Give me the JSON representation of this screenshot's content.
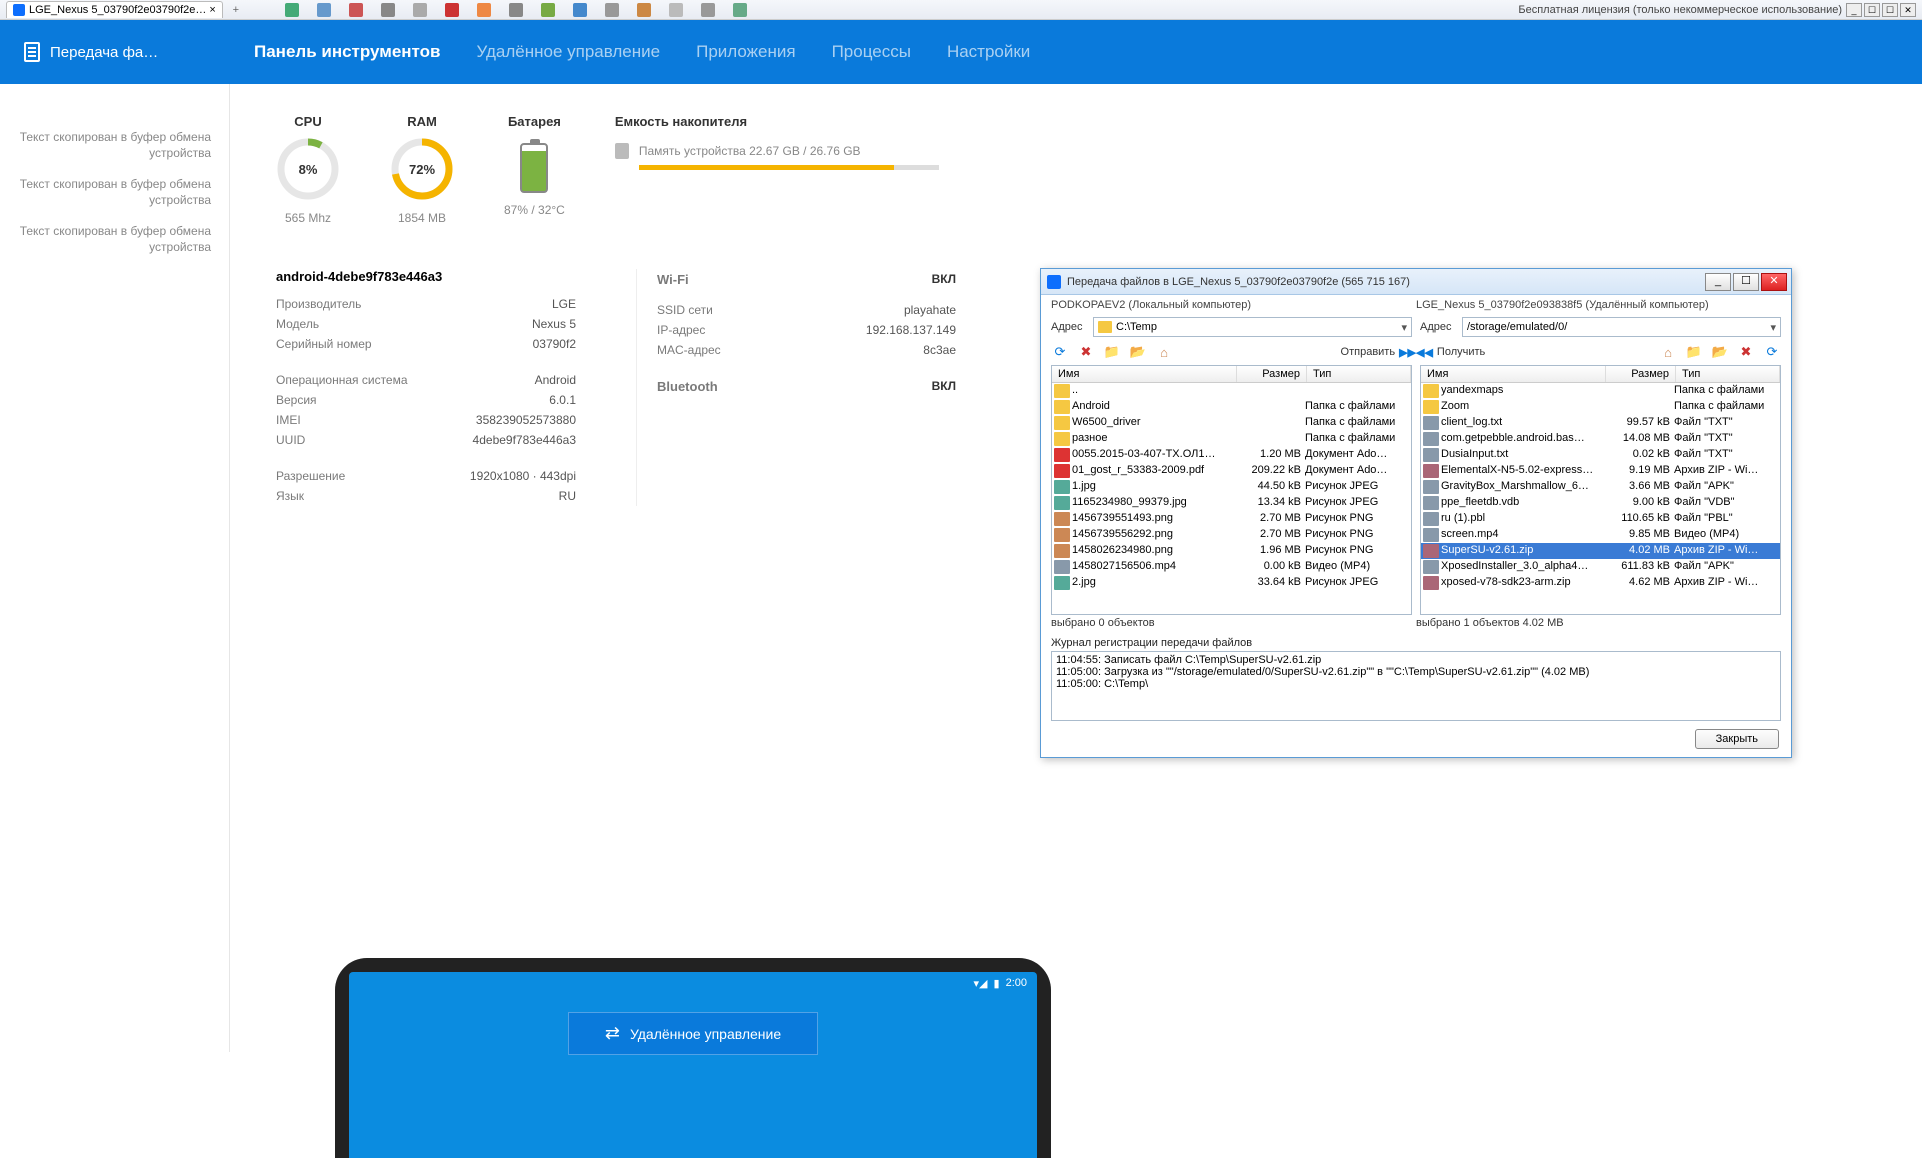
{
  "browser": {
    "tab_title": "LGE_Nexus 5_03790f2e03790f2e… ×",
    "license": "Бесплатная лицензия (только некоммерческое использование)"
  },
  "topbar": {
    "app_title": "Передача фа…",
    "nav": {
      "panel": "Панель инструментов",
      "remote": "Удалённое управление",
      "apps": "Приложения",
      "proc": "Процессы",
      "settings": "Настройки"
    }
  },
  "sidebar": {
    "msg": "Текст скопирован в буфер обмена устройства"
  },
  "stats": {
    "cpu_label": "CPU",
    "cpu_pct": "8%",
    "cpu_sub": "565 Mhz",
    "ram_label": "RAM",
    "ram_pct": "72%",
    "ram_sub": "1854 MB",
    "bat_label": "Батарея",
    "bat_sub": "87% / 32°C",
    "storage_label": "Емкость накопителя",
    "storage_text": "Память устройства 22.67 GB / 26.76 GB"
  },
  "device": {
    "id": "android-4debe9f783e446a3",
    "rows1": [
      {
        "k": "Производитель",
        "v": "LGE"
      },
      {
        "k": "Модель",
        "v": "Nexus 5"
      },
      {
        "k": "Серийный номер",
        "v": "03790f2"
      }
    ],
    "rows2": [
      {
        "k": "Операционная система",
        "v": "Android"
      },
      {
        "k": "Версия",
        "v": "6.0.1"
      },
      {
        "k": "IMEI",
        "v": "358239052573880"
      },
      {
        "k": "UUID",
        "v": "4debe9f783e446a3"
      }
    ],
    "rows3": [
      {
        "k": "Разрешение",
        "v": "1920x1080 · 443dpi"
      },
      {
        "k": "Язык",
        "v": "RU"
      }
    ],
    "wifi_h": "Wi-Fi",
    "wifi_on": "ВКЛ",
    "wrows": [
      {
        "k": "SSID сети",
        "v": "playahate"
      },
      {
        "k": "IP-адрес",
        "v": "192.168.137.149"
      },
      {
        "k": "MAC-адрес",
        "v": "8c3ae"
      }
    ],
    "bt_h": "Bluetooth",
    "bt_on": "ВКЛ"
  },
  "ft": {
    "title": "Передача файлов в LGE_Nexus 5_03790f2e03790f2e (565 715 167)",
    "local_label": "PODKOPAEV2 (Локальный компьютер)",
    "remote_label": "LGE_Nexus 5_03790f2e093838f5 (Удалённый компьютер)",
    "addr_label": "Адрес",
    "local_path": "C:\\Temp",
    "remote_path": "/storage/emulated/0/",
    "send": "Отправить",
    "recv": "Получить",
    "col_name": "Имя",
    "col_size": "Размер",
    "col_type": "Тип",
    "local_files": [
      {
        "ico": "fld",
        "n": "..",
        "s": "",
        "t": ""
      },
      {
        "ico": "fld",
        "n": "Android",
        "s": "",
        "t": "Папка с файлами"
      },
      {
        "ico": "fld",
        "n": "W6500_driver",
        "s": "",
        "t": "Папка с файлами"
      },
      {
        "ico": "fld",
        "n": "разное",
        "s": "",
        "t": "Папка с файлами"
      },
      {
        "ico": "pdf",
        "n": "0055.2015-03-407-ТХ.ОЛ1…",
        "s": "1.20 MB",
        "t": "Документ Ado…"
      },
      {
        "ico": "pdf",
        "n": "01_gost_r_53383-2009.pdf",
        "s": "209.22 kB",
        "t": "Документ Ado…"
      },
      {
        "ico": "img",
        "n": "1.jpg",
        "s": "44.50 kB",
        "t": "Рисунок JPEG"
      },
      {
        "ico": "img",
        "n": "1165234980_99379.jpg",
        "s": "13.34 kB",
        "t": "Рисунок JPEG"
      },
      {
        "ico": "png",
        "n": "1456739551493.png",
        "s": "2.70 MB",
        "t": "Рисунок PNG"
      },
      {
        "ico": "png",
        "n": "1456739556292.png",
        "s": "2.70 MB",
        "t": "Рисунок PNG"
      },
      {
        "ico": "png",
        "n": "1458026234980.png",
        "s": "1.96 MB",
        "t": "Рисунок PNG"
      },
      {
        "ico": "doc",
        "n": "1458027156506.mp4",
        "s": "0.00 kB",
        "t": "Видео (MP4)"
      },
      {
        "ico": "img",
        "n": "2.jpg",
        "s": "33.64 kB",
        "t": "Рисунок JPEG"
      }
    ],
    "remote_files": [
      {
        "ico": "fld",
        "n": "yandexmaps",
        "s": "",
        "t": "Папка с файлами"
      },
      {
        "ico": "fld",
        "n": "Zoom",
        "s": "",
        "t": "Папка с файлами"
      },
      {
        "ico": "doc",
        "n": "client_log.txt",
        "s": "99.57 kB",
        "t": "Файл \"TXT\""
      },
      {
        "ico": "doc",
        "n": "com.getpebble.android.bas…",
        "s": "14.08 MB",
        "t": "Файл \"TXT\""
      },
      {
        "ico": "doc",
        "n": "DusiaInput.txt",
        "s": "0.02 kB",
        "t": "Файл \"TXT\""
      },
      {
        "ico": "zip",
        "n": "ElementalX-N5-5.02-express…",
        "s": "9.19 MB",
        "t": "Архив ZIP - Wi…"
      },
      {
        "ico": "doc",
        "n": "GravityBox_Marshmallow_6…",
        "s": "3.66 MB",
        "t": "Файл \"APK\""
      },
      {
        "ico": "doc",
        "n": "ppe_fleetdb.vdb",
        "s": "9.00 kB",
        "t": "Файл \"VDB\""
      },
      {
        "ico": "doc",
        "n": "ru (1).pbl",
        "s": "110.65 kB",
        "t": "Файл \"PBL\""
      },
      {
        "ico": "doc",
        "n": "screen.mp4",
        "s": "9.85 MB",
        "t": "Видео (MP4)"
      },
      {
        "ico": "zip",
        "n": "SuperSU-v2.61.zip",
        "s": "4.02 MB",
        "t": "Архив ZIP - Wi…",
        "sel": true
      },
      {
        "ico": "doc",
        "n": "XposedInstaller_3.0_alpha4…",
        "s": "611.83 kB",
        "t": "Файл \"APK\""
      },
      {
        "ico": "zip",
        "n": "xposed-v78-sdk23-arm.zip",
        "s": "4.62 MB",
        "t": "Архив ZIP - Wi…"
      }
    ],
    "status_l": "выбрано 0 объектов",
    "status_r": "выбрано 1 объектов   4.02 MB",
    "log_h": "Журнал регистрации передачи файлов",
    "log": [
      "11:04:55: Записать файл C:\\Temp\\SuperSU-v2.61.zip",
      "11:05:00: Загрузка из \"\"/storage/emulated/0/SuperSU-v2.61.zip\"\" в \"\"C:\\Temp\\SuperSU-v2.61.zip\"\" (4.02 MB)",
      "11:05:00: C:\\Temp\\"
    ],
    "close": "Закрыть"
  },
  "phone": {
    "time": "2:00",
    "btn": "Удалённое управление"
  }
}
